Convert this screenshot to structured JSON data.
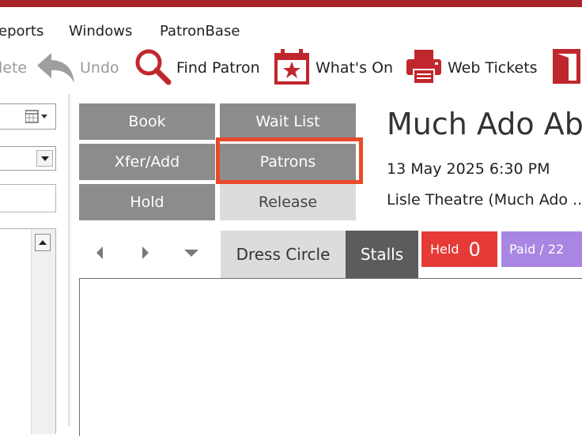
{
  "menu": {
    "reports": "eports",
    "windows": "Windows",
    "patronbase": "PatronBase"
  },
  "toolbar": {
    "delete_label": "lete",
    "undo_label": "Undo",
    "find_patron_label": "Find Patron",
    "whats_on_label": "What's On",
    "web_tickets_label": "Web Tickets"
  },
  "actions": {
    "book": "Book",
    "wait_list": "Wait List",
    "xfer_add": "Xfer/Add",
    "patrons": "Patrons",
    "hold": "Hold",
    "release": "Release"
  },
  "show": {
    "title": "Much Ado Abo",
    "datetime": "13 May 2025 6:30 PM",
    "venue": "Lisle Theatre (Much Ado ..."
  },
  "seating": {
    "tabs": [
      "Dress Circle",
      "Stalls"
    ],
    "held_label": "Held",
    "held_count": "0",
    "paid_label": "Paid / 22"
  },
  "colors": {
    "title_bar": "#a8252a",
    "icon_red": "#c0272d",
    "highlight": "#e84a2a",
    "held": "#e53a36",
    "paid": "#a986e2",
    "button_dark": "#8c8c8c",
    "button_light": "#dcdcdc"
  },
  "icons": [
    "undo-icon",
    "search-icon",
    "calendar-star-icon",
    "printer-icon",
    "exit-door-icon",
    "calendar-dropdown-icon",
    "dropdown-arrow-icon",
    "scroll-up-icon",
    "nav-prev-icon",
    "nav-next-icon",
    "nav-down-icon"
  ]
}
